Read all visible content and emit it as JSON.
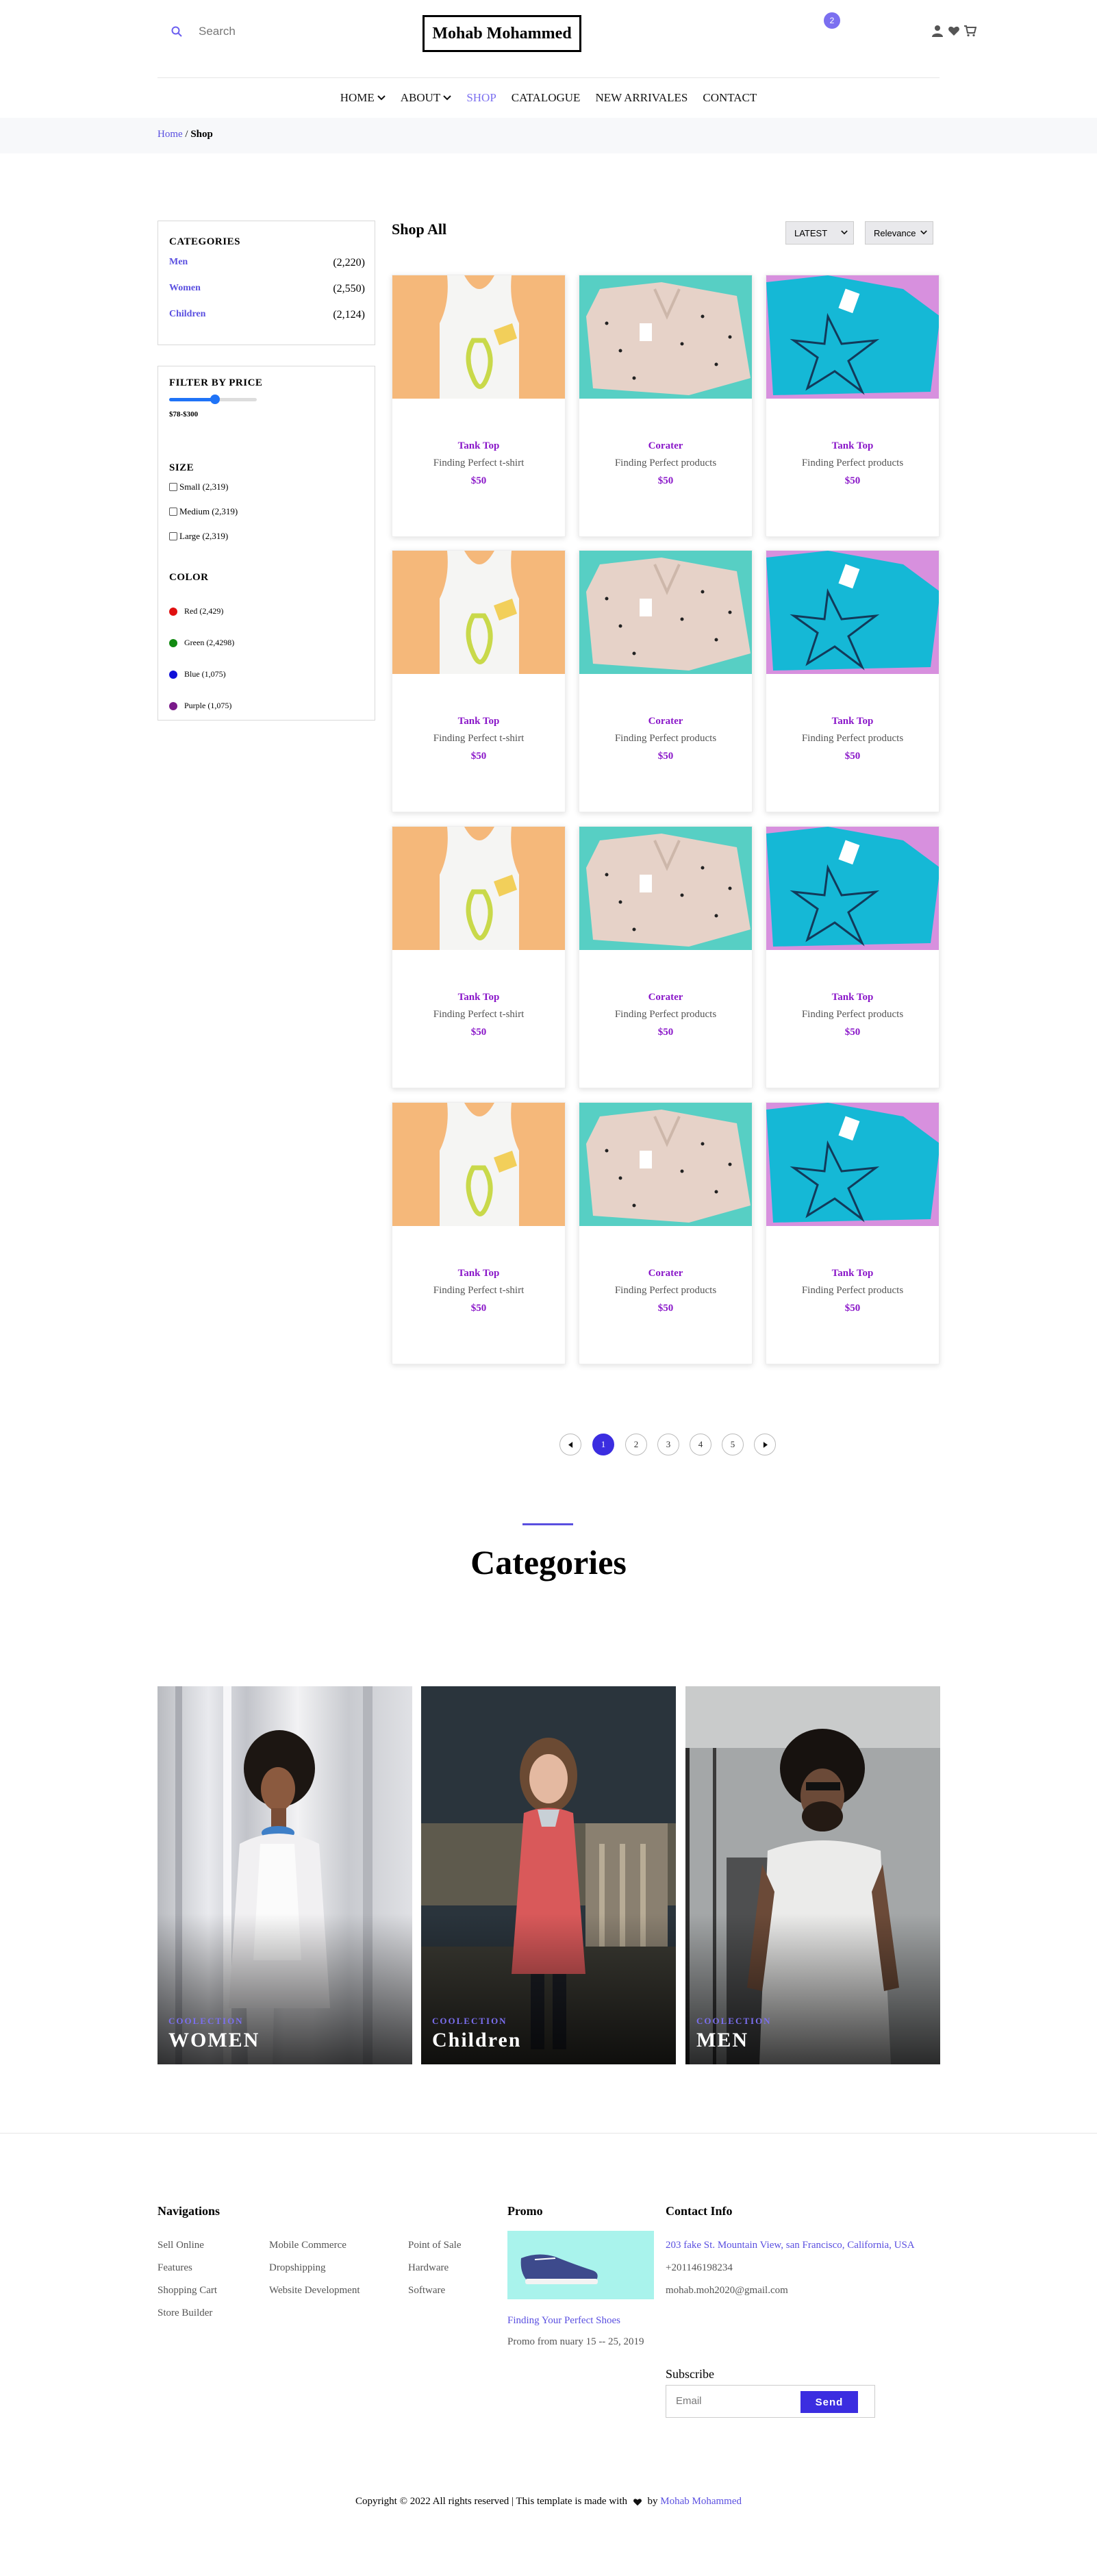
{
  "header": {
    "search_placeholder": "Search",
    "logo": "Mohab Mohammed",
    "cart_count": "2",
    "accent_color": "#7b6ff0"
  },
  "nav": {
    "items": [
      {
        "label": "HOME",
        "dropdown": true
      },
      {
        "label": "ABOUT",
        "dropdown": true
      },
      {
        "label": "SHOP",
        "active": true
      },
      {
        "label": "CATALOGUE"
      },
      {
        "label": "NEW ARRIVALES"
      },
      {
        "label": "CONTACT"
      }
    ]
  },
  "breadcrumb": {
    "home": "Home",
    "separator": "/",
    "current": "Shop"
  },
  "sidebar": {
    "categories_title": "CATEGORIES",
    "categories": [
      {
        "name": "Men",
        "count": "(2,220)"
      },
      {
        "name": "Women",
        "count": "(2,550)"
      },
      {
        "name": "Children",
        "count": "(2,124)"
      }
    ],
    "filter_title": "FILTER BY PRICE",
    "price_range": "$78-$300",
    "size_title": "SIZE",
    "sizes": [
      {
        "label": "Small (2,319)"
      },
      {
        "label": "Medium (2,319)"
      },
      {
        "label": "Large (2,319)"
      }
    ],
    "color_title": "COLOR",
    "colors": [
      {
        "label": "Red (2,429)",
        "color": "#e01010"
      },
      {
        "label": "Green (2,4298)",
        "color": "#128a12"
      },
      {
        "label": "Blue (1,075)",
        "color": "#1010d8"
      },
      {
        "label": "Purple (1,075)",
        "color": "#7a1a8a"
      }
    ]
  },
  "shop": {
    "title": "Shop All",
    "sort_latest": "LATEST",
    "sort_relevance": "Relevance"
  },
  "products": [
    {
      "name": "Tank Top",
      "desc": "Finding Perfect t-shirt",
      "price": "$50",
      "image": "tank-top"
    },
    {
      "name": "Corater",
      "desc": "Finding Perfect products",
      "price": "$50",
      "image": "shirt"
    },
    {
      "name": "Tank Top",
      "desc": "Finding Perfect products",
      "price": "$50",
      "image": "tee"
    },
    {
      "name": "Tank Top",
      "desc": "Finding Perfect t-shirt",
      "price": "$50",
      "image": "tank-top"
    },
    {
      "name": "Corater",
      "desc": "Finding Perfect products",
      "price": "$50",
      "image": "shirt"
    },
    {
      "name": "Tank Top",
      "desc": "Finding Perfect products",
      "price": "$50",
      "image": "tee"
    },
    {
      "name": "Tank Top",
      "desc": "Finding Perfect t-shirt",
      "price": "$50",
      "image": "tank-top"
    },
    {
      "name": "Corater",
      "desc": "Finding Perfect products",
      "price": "$50",
      "image": "shirt"
    },
    {
      "name": "Tank Top",
      "desc": "Finding Perfect products",
      "price": "$50",
      "image": "tee"
    },
    {
      "name": "Tank Top",
      "desc": "Finding Perfect t-shirt",
      "price": "$50",
      "image": "tank-top"
    },
    {
      "name": "Corater",
      "desc": "Finding Perfect products",
      "price": "$50",
      "image": "shirt"
    },
    {
      "name": "Tank Top",
      "desc": "Finding Perfect products",
      "price": "$50",
      "image": "tee"
    }
  ],
  "pagination": {
    "pages": [
      "1",
      "2",
      "3",
      "4",
      "5"
    ],
    "current": "1"
  },
  "categories_section": {
    "title": "Categories",
    "items": [
      {
        "sub": "COOLECTION",
        "title": "WOMEN"
      },
      {
        "sub": "COOLECTION",
        "title": "Children"
      },
      {
        "sub": "COOLECTION",
        "title": "MEN"
      }
    ]
  },
  "footer": {
    "nav_title": "Navigations",
    "nav_col1": [
      "Sell Online",
      "Features",
      "Shopping Cart",
      "Store Builder"
    ],
    "nav_col2": [
      "Mobile Commerce",
      "Dropshipping",
      "Website Development"
    ],
    "nav_col3": [
      "Point of Sale",
      "Hardware",
      "Software"
    ],
    "promo_title": "Promo",
    "promo_link": "Finding Your Perfect Shoes",
    "promo_text": "Promo from nuary 15 -- 25, 2019",
    "contact_title": "Contact Info",
    "address": "203 fake St. Mountain View, san Francisco, California, USA",
    "phone": "+201146198234",
    "email": "mohab.moh2020@gmail.com",
    "subscribe_title": "Subscribe",
    "subscribe_placeholder": "Email",
    "subscribe_button": "Send",
    "copyright_prefix": "Copyright © 2022 All rights reserved | This template is made with",
    "copyright_by": "by",
    "copyright_author": "Mohab Mohammed"
  }
}
